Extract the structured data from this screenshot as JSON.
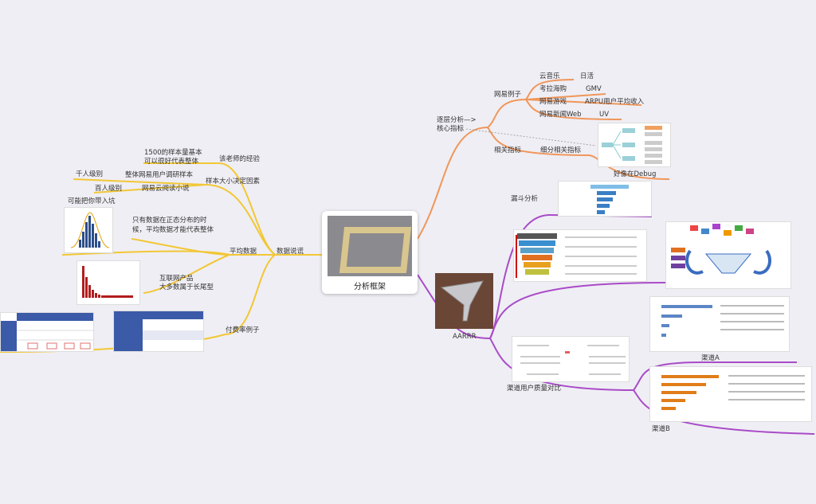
{
  "center": {
    "title": "分析框架"
  },
  "left": {
    "branch_label": "数据说谎",
    "teacher_exp": {
      "label": "该老师的经验",
      "note_line1": "1500的样本量基本",
      "note_line2": "可以很好代表整体"
    },
    "sample_size": {
      "label": "样本大小决定因素",
      "items": [
        {
          "level": "千人级别",
          "desc": "整体网易用户调研样本"
        },
        {
          "level": "百人级别",
          "desc": "网易云阅读小说"
        }
      ]
    },
    "average": {
      "label": "平均数据",
      "pit": "可能把你带入坑",
      "normal_line1": "只有数据在正态分布的时",
      "normal_line2": "候，平均数据才能代表整体",
      "longtail_line1": "互联网产品",
      "longtail_line2": "大多数属于长尾型"
    },
    "payrate": {
      "label": "付费率例子"
    }
  },
  "right": {
    "layered": {
      "label_line1": "逐层分析—>",
      "label_line2": "核心指标",
      "netease": {
        "label": "网易例子",
        "items": [
          {
            "product": "云音乐",
            "metric": "日活"
          },
          {
            "product": "考拉海购",
            "metric": "GMV"
          },
          {
            "product": "网易游戏",
            "metric": "ARPU用户平均收入"
          },
          {
            "product": "网易新闻Web",
            "metric": "UV"
          }
        ]
      },
      "related": {
        "label": "相关指标",
        "sub": "细分相关指标",
        "note": "好像在Debug"
      }
    },
    "aarrr": {
      "label": "AARRR",
      "funnel": "漏斗分析",
      "channel_compare": "渠道用户质量对比",
      "channel_a": "渠道A",
      "channel_b": "渠道B"
    }
  },
  "colors": {
    "orange": "#f0965a",
    "yellow": "#f2c735",
    "purple": "#a94bc8"
  }
}
